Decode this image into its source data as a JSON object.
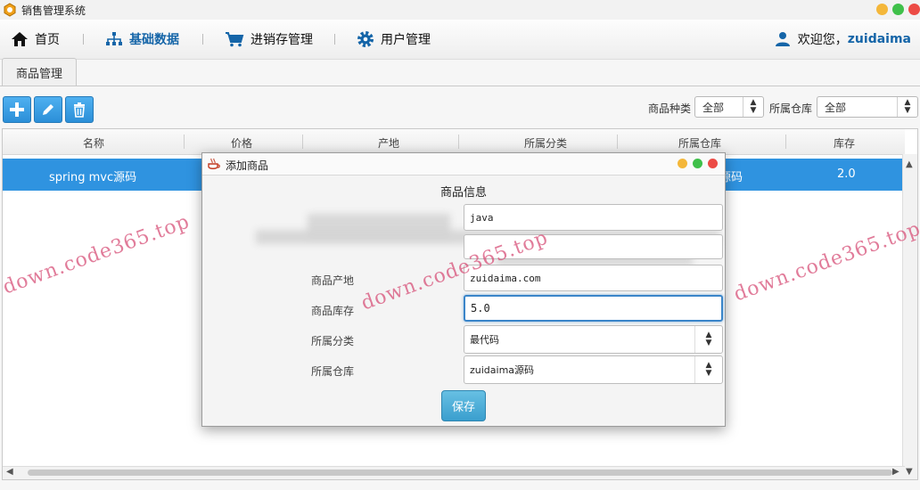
{
  "window": {
    "title": "销售管理系统"
  },
  "nav": {
    "items": [
      {
        "label": "首页",
        "icon": "home-icon",
        "active": false
      },
      {
        "label": "基础数据",
        "icon": "network-icon",
        "active": true
      },
      {
        "label": "进销存管理",
        "icon": "cart-icon",
        "active": false
      },
      {
        "label": "用户管理",
        "icon": "gear-icon",
        "active": false
      }
    ],
    "welcome": "欢迎您，",
    "username": "zuidaima"
  },
  "tab": {
    "label": "商品管理"
  },
  "filters": {
    "category_label": "商品种类",
    "category_value": "全部",
    "warehouse_label": "所属仓库",
    "warehouse_value": "全部"
  },
  "table": {
    "columns": [
      "名称",
      "价格",
      "产地",
      "所属分类",
      "所属仓库",
      "库存"
    ],
    "rows": [
      {
        "name": "spring mvc源码",
        "price": "",
        "origin": "",
        "category": "",
        "warehouse": "源码",
        "stock": "2.0"
      }
    ]
  },
  "watermark": "down.code365.top",
  "dialog": {
    "title": "添加商品",
    "section": "商品信息",
    "fields": [
      {
        "label": "",
        "value": "java"
      },
      {
        "label": "",
        "value": ""
      },
      {
        "label": "商品产地",
        "value": "zuidaima.com"
      },
      {
        "label": "商品库存",
        "value": "5.0"
      },
      {
        "label": "所属分类",
        "value": "最代码"
      },
      {
        "label": "所属仓库",
        "value": "zuidaima源码"
      }
    ],
    "save_label": "保存"
  },
  "colors": {
    "accent": "#2f93e0",
    "brand_text": "#1565a8",
    "watermark": "#d75078"
  }
}
